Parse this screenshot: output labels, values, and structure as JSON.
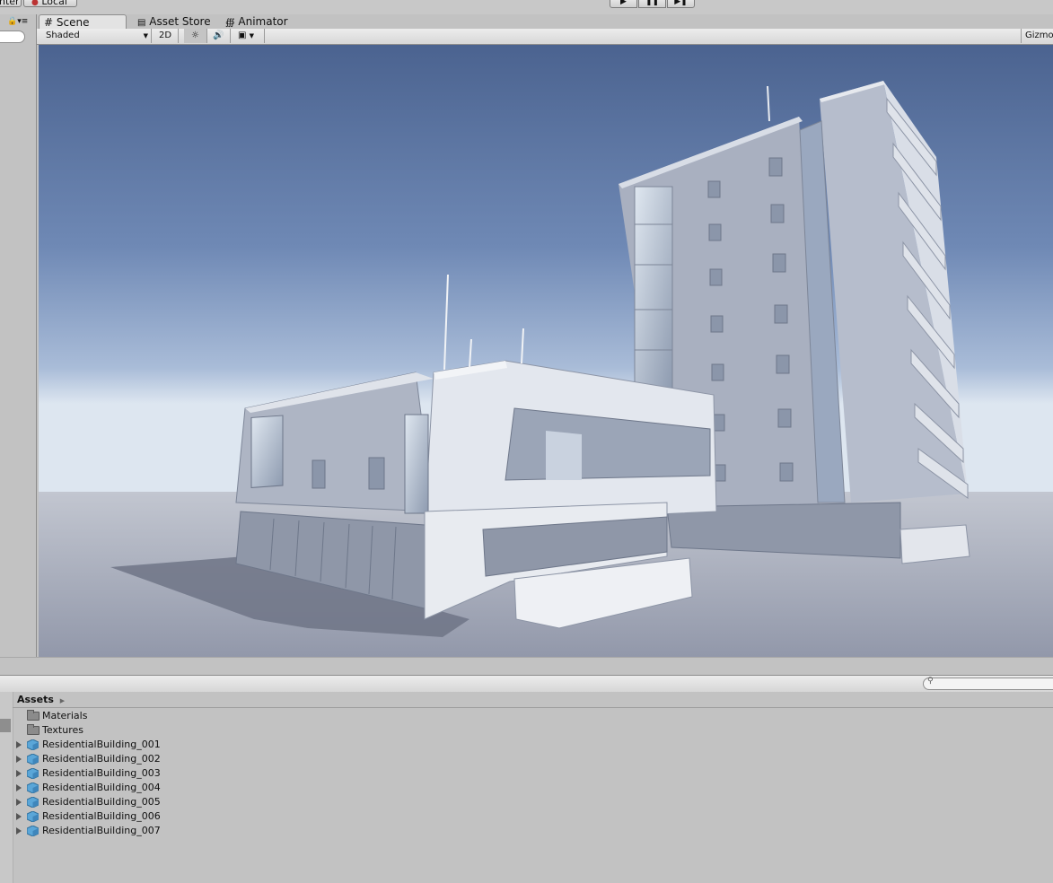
{
  "toolbar": {
    "pivot_label": "nter",
    "space_label": "Local",
    "play_icon": "play-icon",
    "pause_icon": "pause-icon",
    "step_icon": "step-icon"
  },
  "tabs": [
    {
      "label": "Scene",
      "icon": "hash-icon",
      "active": true
    },
    {
      "label": "Asset Store",
      "icon": "store-icon",
      "active": false
    },
    {
      "label": "Animator",
      "icon": "animator-icon",
      "active": false
    }
  ],
  "scene_toolbar": {
    "draw_mode": "Shaded",
    "mode_2d": "2D",
    "gizmos": "Gizmo"
  },
  "project": {
    "breadcrumb": "Assets",
    "items": [
      {
        "label": "Materials",
        "type": "folder"
      },
      {
        "label": "Textures",
        "type": "folder"
      },
      {
        "label": "ResidentialBuilding_001",
        "type": "prefab"
      },
      {
        "label": "ResidentialBuilding_002",
        "type": "prefab"
      },
      {
        "label": "ResidentialBuilding_003",
        "type": "prefab"
      },
      {
        "label": "ResidentialBuilding_004",
        "type": "prefab"
      },
      {
        "label": "ResidentialBuilding_005",
        "type": "prefab"
      },
      {
        "label": "ResidentialBuilding_006",
        "type": "prefab"
      },
      {
        "label": "ResidentialBuilding_007",
        "type": "prefab"
      }
    ]
  },
  "colors": {
    "sky_top": "#4c6592",
    "sky_horizon": "#d4dde9",
    "ground": "#9da4b5",
    "building": "#c3c9d6"
  }
}
